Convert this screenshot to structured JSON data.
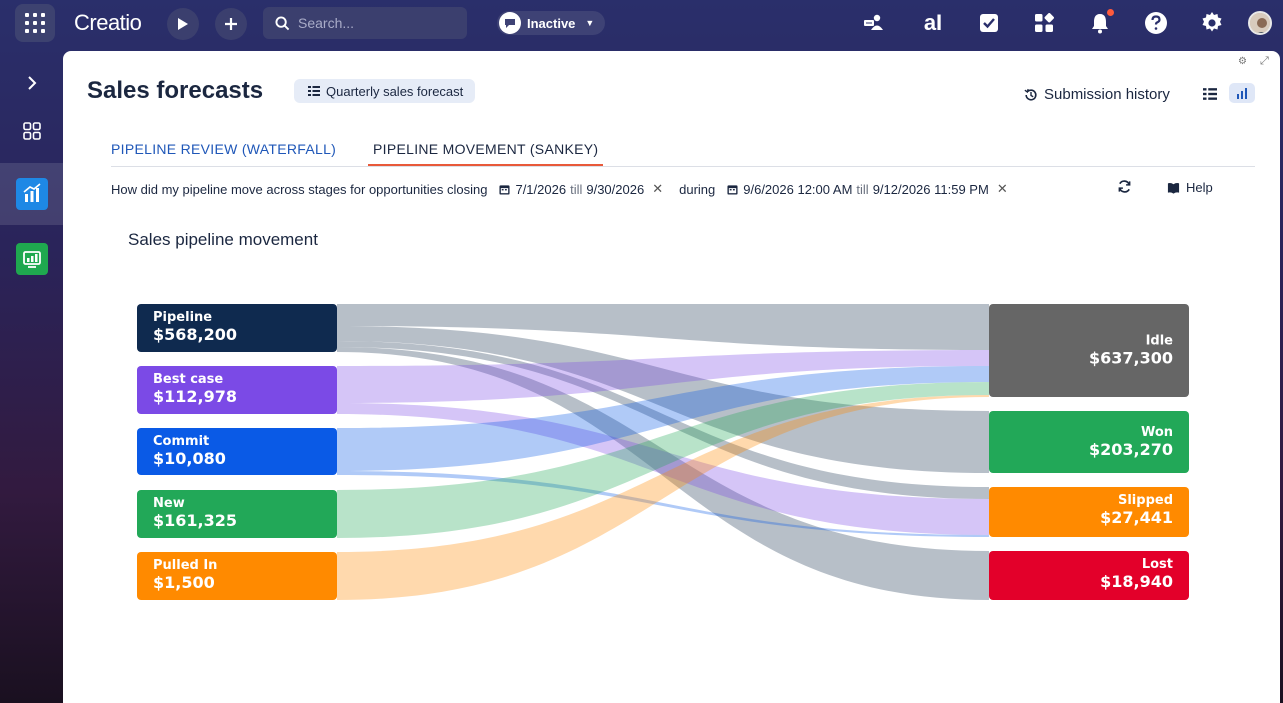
{
  "topbar": {
    "logo": "Creatio",
    "search_placeholder": "Search...",
    "status": "Inactive"
  },
  "page": {
    "title": "Sales forecasts",
    "forecast_chip": "Quarterly sales forecast",
    "submission_history": "Submission history"
  },
  "tabs": [
    {
      "label": "PIPELINE REVIEW (WATERFALL)",
      "active": false
    },
    {
      "label": "PIPELINE MOVEMENT (SANKEY)",
      "active": true
    }
  ],
  "filter": {
    "question": "How did my pipeline move across stages for opportunities closing",
    "close_from": "7/1/2026",
    "close_till_word": "till",
    "close_to": "9/30/2026",
    "during_word": "during",
    "period_from": "9/6/2026 12:00 AM",
    "period_till_word": "till",
    "period_to": "9/12/2026 11:59 PM",
    "help": "Help"
  },
  "chart_data": {
    "type": "sankey",
    "title": "Sales pipeline movement",
    "sources": [
      {
        "name": "Pipeline",
        "value": "$568,200",
        "color": "#0f2a4f"
      },
      {
        "name": "Best case",
        "value": "$112,978",
        "color": "#7b4ae6"
      },
      {
        "name": "Commit",
        "value": "$10,080",
        "color": "#0a5ae6"
      },
      {
        "name": "New",
        "value": "$161,325",
        "color": "#22a858"
      },
      {
        "name": "Pulled In",
        "value": "$1,500",
        "color": "#ff8a00"
      }
    ],
    "targets": [
      {
        "name": "Idle",
        "value": "$637,300",
        "color": "#666666"
      },
      {
        "name": "Won",
        "value": "$203,270",
        "color": "#22a858"
      },
      {
        "name": "Slipped",
        "value": "$27,441",
        "color": "#ff8a00"
      },
      {
        "name": "Lost",
        "value": "$18,940",
        "color": "#e3002a"
      }
    ]
  }
}
